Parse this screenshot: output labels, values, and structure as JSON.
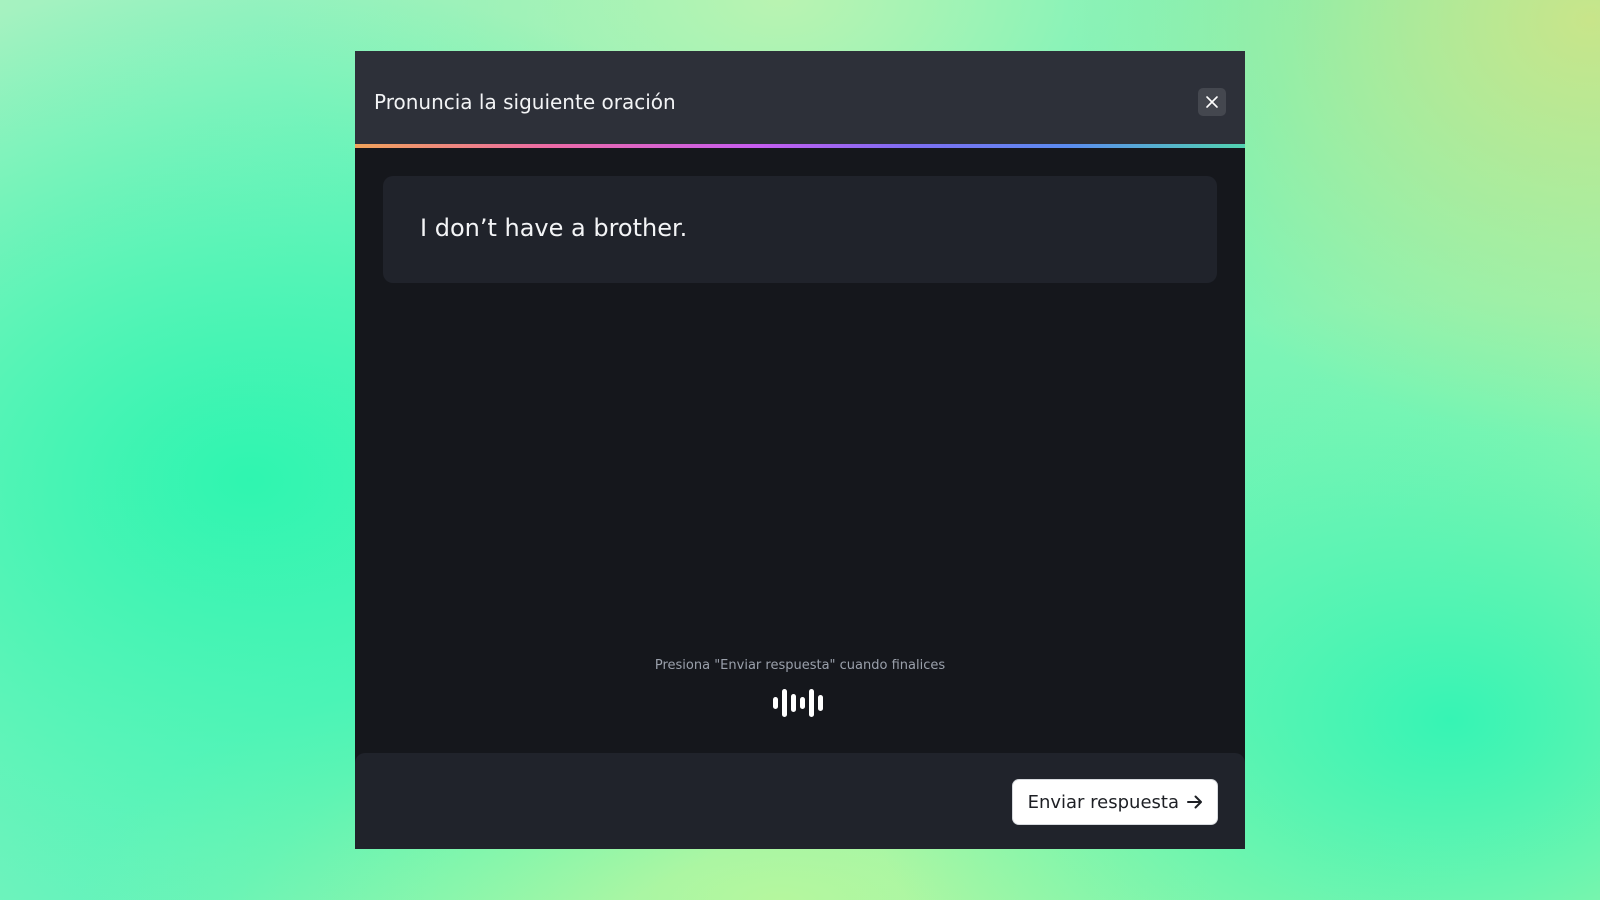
{
  "modal": {
    "title": "Pronuncia la siguiente oración",
    "close_icon": "close-icon"
  },
  "prompt": {
    "sentence": "I don’t have a brother."
  },
  "recorder": {
    "hint": "Presiona \"Enviar respuesta\" cuando finalices",
    "waveform_icon": "audio-waveform-icon"
  },
  "footer": {
    "submit_label": "Enviar respuesta",
    "submit_icon": "arrow-right-icon"
  },
  "colors": {
    "panel": "#15171c",
    "header": "#2d3039",
    "card": "#20232b",
    "accent_gradient": [
      "#f0a35a",
      "#ec6aa6",
      "#c75df0",
      "#7f6df2",
      "#5b8cf0",
      "#52d3b0"
    ]
  }
}
